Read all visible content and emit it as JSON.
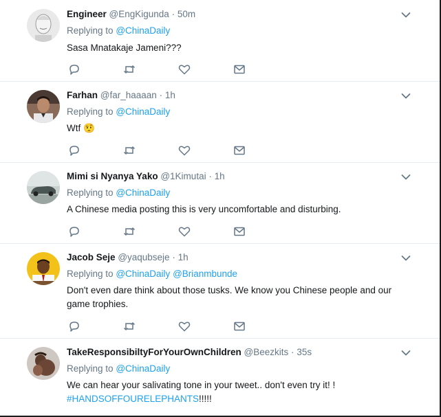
{
  "replying_label": "Replying to",
  "tweets": [
    {
      "name": "Engineer",
      "handle": "@EngKigunda",
      "sep": "·",
      "time": "50m",
      "mentions": [
        "@ChinaDaily"
      ],
      "text": "Sasa Mnatakaje Jameni???",
      "emoji": ""
    },
    {
      "name": "Farhan",
      "handle": "@far_haaaan",
      "sep": "·",
      "time": "1h",
      "mentions": [
        "@ChinaDaily"
      ],
      "text": "Wtf",
      "emoji": "🤨"
    },
    {
      "name": "Mimi si Nyanya Yako",
      "handle": "@1Kimutai",
      "sep": "·",
      "time": "1h",
      "mentions": [
        "@ChinaDaily"
      ],
      "text": "A Chinese media posting this is very uncomfortable and disturbing.",
      "emoji": ""
    },
    {
      "name": "Jacob Seje",
      "handle": "@yaqubseje",
      "sep": "·",
      "time": "1h",
      "mentions": [
        "@ChinaDaily",
        "@Brianmbunde"
      ],
      "text": "Don't even dare think about those tusks. We know you Chinese people and our game trophies.",
      "emoji": ""
    },
    {
      "name": "TakeResponsibiltyForYourOwnChildren",
      "handle": "@Beezkits",
      "sep": "·",
      "time": "35s",
      "mentions": [
        "@ChinaDaily"
      ],
      "text": "We can hear your salivating tone in your tweet.. don't even try it! !",
      "hashtag": "#HANDSOFFOURELEPHANTS",
      "hashtag_suffix": "!!!!!",
      "emoji": ""
    }
  ],
  "icons": {
    "reply": "reply-icon",
    "retweet": "retweet-icon",
    "like": "like-icon",
    "dm": "direct-message-icon",
    "caret": "chevron-down-icon"
  },
  "colors": {
    "accent": "#1da1f2",
    "muted": "#657786",
    "text": "#14171a",
    "divider": "#e6ecf0"
  }
}
